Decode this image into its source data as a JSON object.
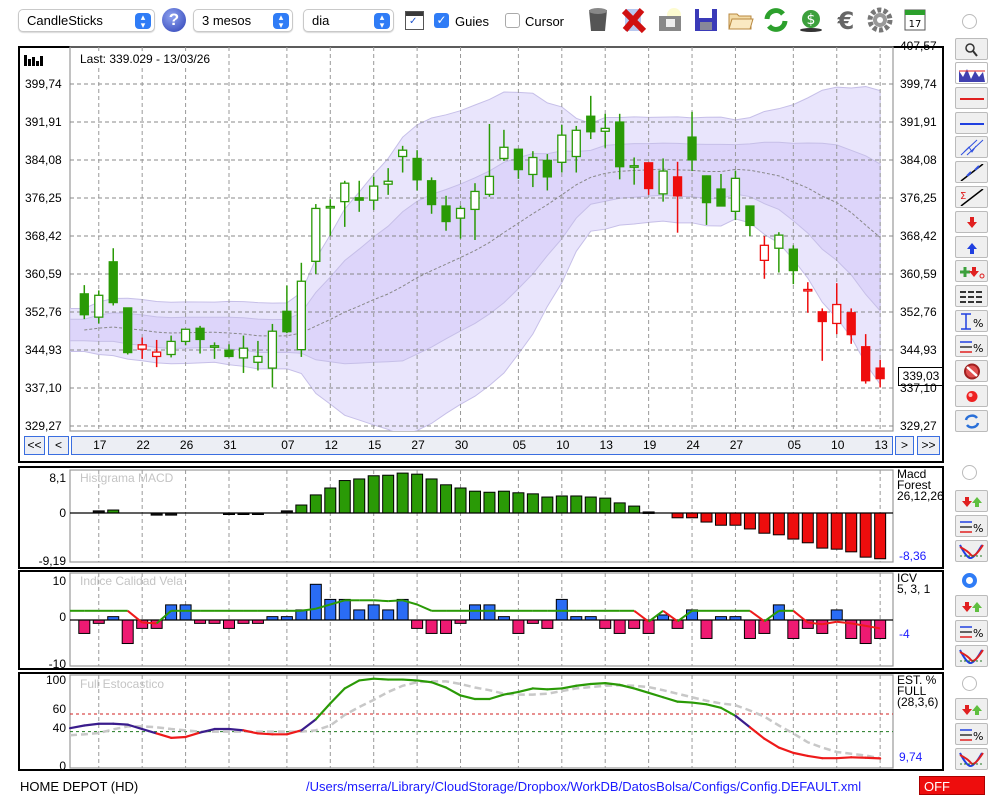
{
  "toolbar": {
    "chart_type": "CandleSticks",
    "period": "3 mesos",
    "interval": "dia",
    "guides_label": "Guies",
    "guides_checked": true,
    "cursor_label": "Cursor",
    "cursor_checked": false
  },
  "main": {
    "last_label": "Last: 339.029 - 13/03/26",
    "price_ticks": [
      "407,57",
      "399,74",
      "391,91",
      "384,08",
      "376,25",
      "368,42",
      "360,59",
      "352,76",
      "344,93",
      "337,10",
      "329,27"
    ],
    "last_price_badge": "339,03",
    "nav": {
      "first": "<<",
      "prev": "<",
      "next": ">",
      "last": ">>"
    },
    "date_labels": [
      {
        "i": 1,
        "t": "17"
      },
      {
        "i": 4,
        "t": "22"
      },
      {
        "i": 7,
        "t": "26"
      },
      {
        "i": 10,
        "t": "31"
      },
      {
        "i": 14,
        "t": "07"
      },
      {
        "i": 17,
        "t": "12"
      },
      {
        "i": 20,
        "t": "15"
      },
      {
        "i": 23,
        "t": "27"
      },
      {
        "i": 26,
        "t": "30"
      },
      {
        "i": 30,
        "t": "05"
      },
      {
        "i": 33,
        "t": "10"
      },
      {
        "i": 36,
        "t": "13"
      },
      {
        "i": 39,
        "t": "19"
      },
      {
        "i": 42,
        "t": "24"
      },
      {
        "i": 45,
        "t": "27"
      },
      {
        "i": 49,
        "t": "05"
      },
      {
        "i": 52,
        "t": "10"
      },
      {
        "i": 55,
        "t": "13"
      }
    ]
  },
  "panels": {
    "macd": {
      "title": "Histgrama MACD",
      "name1": "Macd",
      "name2": "Forest",
      "params": "26,12,26",
      "value": "-8,36",
      "ticks": [
        "8,1",
        "0",
        "-9,19"
      ]
    },
    "icv": {
      "title": "Indice Calidad Vela",
      "name1": "ICV",
      "params": "5, 3, 1",
      "value": "-4",
      "ticks": [
        "10",
        "0",
        "-10"
      ]
    },
    "stoch": {
      "title": "Full Estocastico",
      "name1": "EST. %",
      "name2": "FULL",
      "params": "(28,3,6)",
      "value": "9,74",
      "ticks": [
        "100",
        "60",
        "40",
        "0"
      ]
    }
  },
  "status": {
    "symbol": "HOME DEPOT (HD)",
    "config_path": "/Users/mserra/Library/CloudStorage/Dropbox/WorkDB/DatosBolsa/Configs/Config.DEFAULT.xml",
    "state": "OFF"
  },
  "colors": {
    "up": "#2a9a06",
    "down": "#ee0d0d",
    "icv_pos": "#2a6cf5",
    "icv_neg": "#ee1a72",
    "band_outer": "#e9e5fc",
    "band_inner": "#ddd5fa",
    "last_badge": "#33f0f0",
    "off": "#ee0d0d"
  },
  "chart_data": [
    {
      "type": "candlestick",
      "title": "Last: 339.029 - 13/03/26",
      "ylim": [
        329.27,
        407.57
      ],
      "columns": [
        "open",
        "high",
        "low",
        "close",
        "color"
      ],
      "candles": [
        [
          356.5,
          358.3,
          351.3,
          352.2,
          "g"
        ],
        [
          351.7,
          357.2,
          350.4,
          356.2,
          "g"
        ],
        [
          363.1,
          365.9,
          354.1,
          354.7,
          "g"
        ],
        [
          353.6,
          353.6,
          344.0,
          344.4,
          "g"
        ],
        [
          345.1,
          347.5,
          343.1,
          346.0,
          "r"
        ],
        [
          343.6,
          347.0,
          341.4,
          344.5,
          "r"
        ],
        [
          344.0,
          347.9,
          343.4,
          346.7,
          "g"
        ],
        [
          346.7,
          349.2,
          345.9,
          349.2,
          "g"
        ],
        [
          349.4,
          349.9,
          344.2,
          347.1,
          "g"
        ],
        [
          345.8,
          346.5,
          343.1,
          345.8,
          "g"
        ],
        [
          344.9,
          346.1,
          343.4,
          343.6,
          "g"
        ],
        [
          343.3,
          347.9,
          340.2,
          345.3,
          "g"
        ],
        [
          342.4,
          346.8,
          340.7,
          343.6,
          "g"
        ],
        [
          341.2,
          350.3,
          337.2,
          348.8,
          "g"
        ],
        [
          352.9,
          358.2,
          348.4,
          348.7,
          "g"
        ],
        [
          345.0,
          362.9,
          343.5,
          359.1,
          "g"
        ],
        [
          363.2,
          375.0,
          360.6,
          374.1,
          "g"
        ],
        [
          374.5,
          376.0,
          368.5,
          374.5,
          "g"
        ],
        [
          375.5,
          379.8,
          370.3,
          379.3,
          "g"
        ],
        [
          376.3,
          379.8,
          373.4,
          375.8,
          "g"
        ],
        [
          375.8,
          380.6,
          373.8,
          378.7,
          "g"
        ],
        [
          379.1,
          382.4,
          376.9,
          379.7,
          "g"
        ],
        [
          384.8,
          387.0,
          381.5,
          386.1,
          "g"
        ],
        [
          384.4,
          386.1,
          377.8,
          380.0,
          "g"
        ],
        [
          379.8,
          380.5,
          373.0,
          374.9,
          "g"
        ],
        [
          374.6,
          376.7,
          369.5,
          371.4,
          "g"
        ],
        [
          372.1,
          374.7,
          367.9,
          374.1,
          "g"
        ],
        [
          373.9,
          379.3,
          367.6,
          377.6,
          "g"
        ],
        [
          377.0,
          391.5,
          376.5,
          380.7,
          "g"
        ],
        [
          384.4,
          390.3,
          383.9,
          386.7,
          "g"
        ],
        [
          386.3,
          386.3,
          380.2,
          382.1,
          "g"
        ],
        [
          381.1,
          385.9,
          378.5,
          384.6,
          "g"
        ],
        [
          384.0,
          385.3,
          377.8,
          380.6,
          "g"
        ],
        [
          383.6,
          391.3,
          381.5,
          389.2,
          "g"
        ],
        [
          384.8,
          391.1,
          381.5,
          390.2,
          "g"
        ],
        [
          393.1,
          397.3,
          388.4,
          389.9,
          "g"
        ],
        [
          390.0,
          393.6,
          386.6,
          390.6,
          "g"
        ],
        [
          391.9,
          393.6,
          380.1,
          382.7,
          "g"
        ],
        [
          382.6,
          384.6,
          379.0,
          382.9,
          "g"
        ],
        [
          383.5,
          383.5,
          376.9,
          378.2,
          "r"
        ],
        [
          377.1,
          384.4,
          375.5,
          381.8,
          "g"
        ],
        [
          380.6,
          383.7,
          369.1,
          376.7,
          "r"
        ],
        [
          388.8,
          394.0,
          381.8,
          384.1,
          "g"
        ],
        [
          380.8,
          380.9,
          370.7,
          375.3,
          "g"
        ],
        [
          378.1,
          381.2,
          374.5,
          374.6,
          "g"
        ],
        [
          373.5,
          381.9,
          371.7,
          380.3,
          "g"
        ],
        [
          374.6,
          374.7,
          368.4,
          370.6,
          "g"
        ],
        [
          363.4,
          368.4,
          359.6,
          366.5,
          "r"
        ],
        [
          365.9,
          369.2,
          360.9,
          368.6,
          "g"
        ],
        [
          365.7,
          366.5,
          358.5,
          361.3,
          "g"
        ],
        [
          357.4,
          358.9,
          352.6,
          357.4,
          "r"
        ],
        [
          352.8,
          353.5,
          342.7,
          350.8,
          "r"
        ],
        [
          350.4,
          358.7,
          348.2,
          354.3,
          "r"
        ],
        [
          352.6,
          353.5,
          346.2,
          348.1,
          "r"
        ],
        [
          345.6,
          348.2,
          338.0,
          338.6,
          "r"
        ],
        [
          341.2,
          342.9,
          337.2,
          339.03,
          "r"
        ]
      ],
      "overlay": "bollinger bands (inner and outer) with dotted middle average"
    },
    {
      "type": "bar",
      "title": "Histgrama MACD",
      "ylim": [
        -9.19,
        8.1
      ],
      "values": [
        0,
        0.4,
        0.56,
        0,
        0,
        -0.4,
        -0.4,
        0,
        0,
        0,
        -0.2,
        -0.2,
        -0.2,
        0,
        0.4,
        1.5,
        3.4,
        4.7,
        6.1,
        6.4,
        7.0,
        7.1,
        7.5,
        7.3,
        6.4,
        5.3,
        4.7,
        4.1,
        3.9,
        4.1,
        3.8,
        3.6,
        3.0,
        3.2,
        3.2,
        3.0,
        2.8,
        1.9,
        1.3,
        0.2,
        0,
        -0.9,
        -0.9,
        -1.7,
        -2.3,
        -2.3,
        -3.0,
        -3.8,
        -4.1,
        -4.9,
        -5.6,
        -6.6,
        -6.8,
        -7.3,
        -8.3,
        -8.6
      ]
    },
    {
      "type": "bar+line",
      "title": "Indice Calidad Vela",
      "ylim": [
        -10,
        10
      ],
      "values": [
        -3.2,
        -0.8,
        0.8,
        -5.6,
        -2,
        -2,
        3.6,
        3.6,
        -0.8,
        -0.8,
        -2,
        -0.8,
        -0.8,
        0.8,
        0.8,
        2.4,
        8.5,
        4.9,
        4.9,
        2.4,
        3.6,
        2.4,
        4.9,
        -2,
        -3.2,
        -3.2,
        -0.8,
        3.6,
        3.6,
        0.8,
        -3.2,
        -0.8,
        -2,
        4.9,
        0.8,
        0.8,
        -2,
        -3.2,
        -2,
        -3.2,
        1.2,
        -2,
        2.4,
        -4.4,
        0.8,
        0.8,
        -4.4,
        -3.2,
        3.6,
        -4.4,
        -2,
        -3.2,
        2.4,
        -4.4,
        -5.6,
        -4.4
      ],
      "line": [
        1,
        1,
        1,
        1,
        -1.8,
        -2,
        1,
        1,
        1,
        1,
        1,
        1,
        1,
        1,
        1,
        1,
        1.5,
        2.5,
        3.5,
        3.5,
        3.5,
        3.3,
        3.5,
        2.5,
        1,
        1,
        1,
        1,
        1,
        1,
        1,
        1,
        1,
        1,
        1,
        1,
        1,
        1,
        1,
        -1.6,
        1,
        -1.5,
        1,
        1,
        1,
        1,
        1,
        -1.5,
        1,
        1,
        -1.8,
        -2.2,
        -1.6,
        -2,
        -2.6,
        -3.2
      ]
    },
    {
      "type": "line",
      "title": "Full Estocastico",
      "ylim": [
        0,
        100
      ],
      "levels": [
        60,
        40
      ],
      "series": [
        {
          "name": "%K",
          "values": [
            47,
            49,
            49,
            48,
            43,
            38,
            33,
            34,
            39,
            43,
            43,
            41.5,
            38,
            37,
            37,
            41.5,
            54,
            72,
            89,
            98,
            100,
            99,
            99,
            98,
            96,
            90,
            81,
            77,
            77,
            82,
            85,
            89,
            88,
            89,
            92,
            94,
            95,
            93,
            89,
            84,
            79,
            74,
            73,
            71,
            67,
            58,
            45,
            32,
            22,
            16,
            12.5,
            10,
            10,
            11,
            10.5,
            9.74
          ]
        },
        {
          "name": "%D",
          "values": [
            37,
            38.5,
            42.6,
            46,
            46,
            45,
            43,
            41.5,
            40,
            40,
            40,
            40,
            40,
            40,
            40,
            40,
            41.5,
            47,
            59,
            68,
            76,
            85,
            92,
            96,
            97,
            97,
            94,
            90,
            87,
            83,
            82,
            82,
            83,
            86,
            89,
            90.5,
            92,
            92.5,
            92,
            90.5,
            87,
            83,
            79,
            75,
            72,
            70,
            64,
            57,
            47,
            38,
            28,
            22,
            17,
            15,
            13,
            10
          ]
        }
      ]
    }
  ]
}
